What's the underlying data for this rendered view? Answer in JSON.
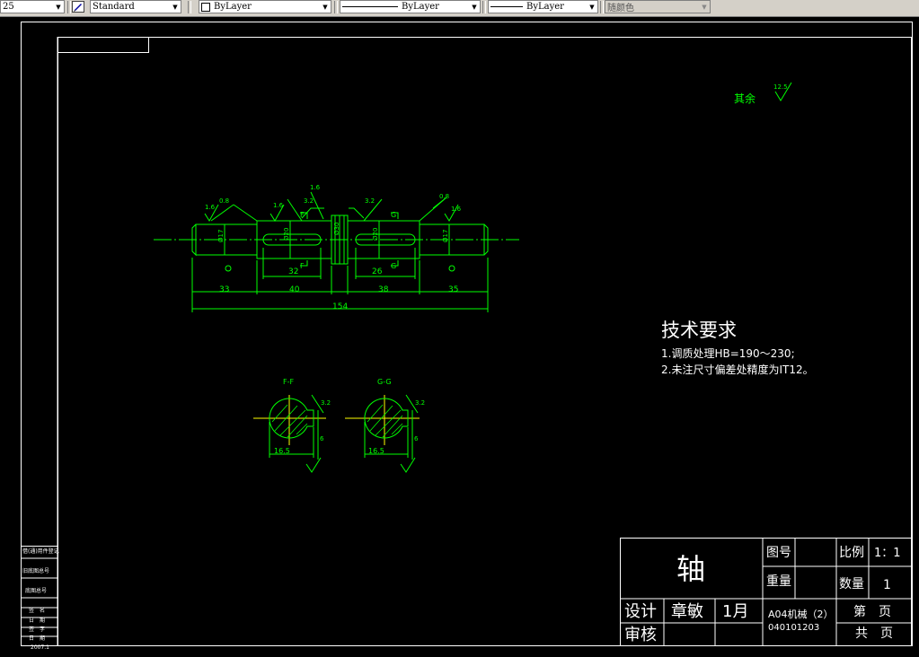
{
  "toolbar": {
    "scale_value": "25",
    "text_style": "Standard",
    "layer": "ByLayer",
    "linetype": "ByLayer",
    "lineweight": "ByLayer",
    "color": "随颜色"
  },
  "drawing": {
    "roughness_note": "其余",
    "roughness_note_value": "12.5",
    "dims": {
      "d33": "33",
      "d40": "40",
      "d38": "38",
      "d35": "35",
      "d154": "154",
      "d32": "32",
      "d26": "26",
      "r16a": "1.6",
      "r16b": "1.6",
      "r16c": "1.6",
      "r16d": "1.6",
      "r08a": "0.8",
      "r08b": "0.8",
      "r32a": "3.2",
      "r32b": "3.2",
      "dia_a": "Ø17",
      "dia_b": "Ø20",
      "dia_c": "Ø30",
      "dia_d": "Ø20",
      "dia_e": "Ø17",
      "sec_f_w": "16.5",
      "sec_g_w": "16.5",
      "sec_f_h": "6",
      "sec_g_h": "6",
      "sec_r_f": "3.2",
      "sec_r_g": "3.2"
    },
    "section_f": "F-F",
    "section_g": "G-G",
    "cut_f1": "F",
    "cut_f2": "F",
    "cut_g1": "G",
    "cut_g2": "G",
    "tech_title": "技术要求",
    "tech_items": [
      "1.调质处理HB=190～230;",
      "2.未注尺寸偏差处精度为IT12。"
    ]
  },
  "title_block": {
    "part_name": "轴",
    "drawing_no_label": "图号",
    "scale_label": "比例",
    "scale_value": "1：1",
    "weight_label": "重量",
    "qty_label": "数量",
    "qty_value": "1",
    "design_label": "设计",
    "designer": "章敏",
    "design_date": "1月",
    "check_label": "审核",
    "class_name": "A04机械（2）",
    "student_no": "040101203",
    "sheet_label": "第　页",
    "total_label": "共　页"
  },
  "sidebar": {
    "labels": [
      "借(通)用件登记",
      "旧底图总号",
      "底图总号",
      "签　名",
      "日　期",
      "签　字",
      "日　期",
      "2007.1"
    ]
  },
  "colors": {
    "background": "#000000",
    "geometry": "#00ff00",
    "frame": "#ffffff",
    "toolbar": "#d4d0c8"
  }
}
